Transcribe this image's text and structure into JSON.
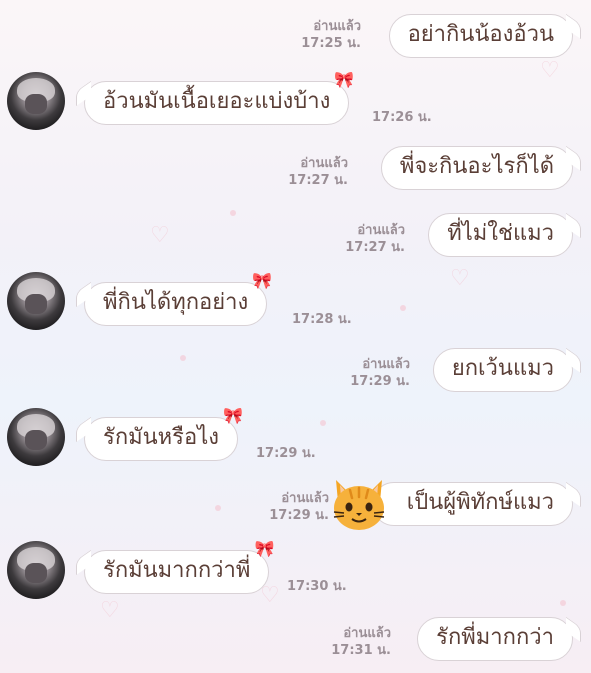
{
  "colors": {
    "bubble_text": "#5a3e36",
    "meta_text": "#9b8f96",
    "bubble_border": "#d9d2d6"
  },
  "messages": [
    {
      "side": "right",
      "text": "อย่ากินน้องอ้วน",
      "read": "อ่านแล้ว",
      "time": "17:25 น."
    },
    {
      "side": "left",
      "text": "อ้วนมันเนื้อเยอะแบ่งบ้าง",
      "time": "17:26 น."
    },
    {
      "side": "right",
      "text": "พี่จะกินอะไรก็ได้",
      "read": "อ่านแล้ว",
      "time": "17:27 น."
    },
    {
      "side": "right",
      "text": "ที่ไม่ใช่แมว",
      "read": "อ่านแล้ว",
      "time": "17:27 น."
    },
    {
      "side": "left",
      "text": "พี่กินได้ทุกอย่าง",
      "time": "17:28 น."
    },
    {
      "side": "right",
      "text": "ยกเว้นแมว",
      "read": "อ่านแล้ว",
      "time": "17:29 น."
    },
    {
      "side": "left",
      "text": "รักมันหรือไง",
      "time": "17:29 น."
    },
    {
      "side": "right",
      "text": "เป็นผู้พิทักษ์แมว",
      "read": "อ่านแล้ว",
      "time": "17:29 น.",
      "icon": "cat-face-icon"
    },
    {
      "side": "left",
      "text": "รักมันมากกว่าพี่",
      "time": "17:30 น."
    },
    {
      "side": "right",
      "text": "รักพี่มากกว่า",
      "read": "อ่านแล้ว",
      "time": "17:31 น."
    }
  ]
}
